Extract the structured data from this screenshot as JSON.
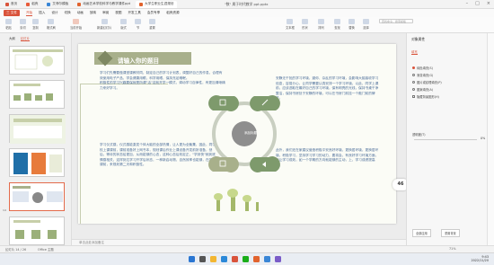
{
  "titlebar": {
    "tabs": [
      {
        "label": "首页",
        "color": "#d9533b"
      },
      {
        "label": "稻壳",
        "color": "#e85b3a"
      },
      {
        "label": "艾菲尔模板",
        "color": "#3a86d6"
      },
      {
        "label": "动画艺术学校科学与教学课件ppt",
        "color": "#e1632e"
      },
      {
        "label": "大学生职业生涯规划",
        "color": "#e1632e"
      }
    ],
    "doc_title": "\"数\" 属于时代教学 ppt.pptx"
  },
  "menu": {
    "start": "三 文件",
    "items": [
      "开始",
      "插入",
      "设计",
      "切换",
      "动画",
      "放映",
      "审阅",
      "视图",
      "开发工具",
      "会员专享",
      "稻壳资源"
    ],
    "active_index": 0
  },
  "ribbon": {
    "buttons": [
      "粘贴",
      "剪切",
      "复制",
      "格式刷",
      "当前开始",
      "新建幻灯片",
      "版式",
      "节",
      "重置",
      "文本框",
      "形状",
      "排列",
      "查找",
      "替换",
      "选择"
    ],
    "search_placeholder": "查找命令、搜索模板"
  },
  "thumbs": {
    "tabs": [
      "大纲",
      "幻灯片"
    ],
    "active_tab": 1,
    "numbers": [
      "",
      "",
      "",
      "",
      "14",
      ""
    ],
    "selected_index": 4
  },
  "slide": {
    "title": "请输入你的题目",
    "center_label": "添加标题",
    "para_top_left": "学习们先需要做课堂课教材同，制定自己的学习计划表，调整好自己的作息，合理有效使用电子产品，学会健康用眼，科学用眼，保持充足睡眠。\n积极性的学习兴趣要保就是所谓\"活\"这就开学一模式，调动学习自律性，有更加清晰精力来好学习。",
    "para_top_right": "安静无干扰的学习环境，避你、杂乱的学习环境，会影响大脑接收学习信息，容易分心，让同学需要认真安排一个学习环境，以此，同学上课前，应该选取在最好自己的学习环境，保有明亮的光线，保持书桌干净整洁，保持书房处于安静的环境，可以在书房门前挂一个敲门前的牌子。",
    "para_bottom_left": "学习仪式感，仪式感能激发个体大脑的全部热情，让人更为全聚集，因此，同学校上课课前，课前准备好上网书本，规划课后作业上课设备开发前所准备，然后，等待的状态给更加，从而能够的心态，这种心态后效定正，\"学到快\"就到底情感相关，这样到达学习开学后状态，一种新启动物，自然效率也能够，在学习课前，来规划第二天和积极性。",
    "para_bottom_right": "此外，我们还在家建议营造积极平安良好环境，更换居环境，更换居环境，积极学习，坚持学习学习的动力，要将会，有良好学习环境方面，就让学习成效，如一个学期的方向就能够的主动，上，学习成绩提高好。"
  },
  "notes": {
    "placeholder": "单击此处添加备注"
  },
  "rightpanel": {
    "title": "对象属性",
    "tab": "填充",
    "options": [
      "纯色填充(S)",
      "渐变填充(G)",
      "图片或纹理填充(P)",
      "图案填充(A)",
      "隐藏背景图形(H)"
    ],
    "selected_option": 0,
    "transparency_label": "透明度(T)",
    "transparency_value": "0%",
    "transparency_fraction": 0.0,
    "apply_all": "全部应用",
    "reset": "重置背景"
  },
  "statusbar": {
    "left": "幻灯片 14 / 26",
    "theme": "Office 主题",
    "zoom": "71%"
  },
  "badge": "46",
  "clock": {
    "time": "9:43",
    "date": "2022/11/20"
  },
  "colors": {
    "accent": "#d9533b",
    "leaf_green": "#7e9a6c",
    "olive": "#a8b08b",
    "text_blue": "#4c6d99"
  }
}
